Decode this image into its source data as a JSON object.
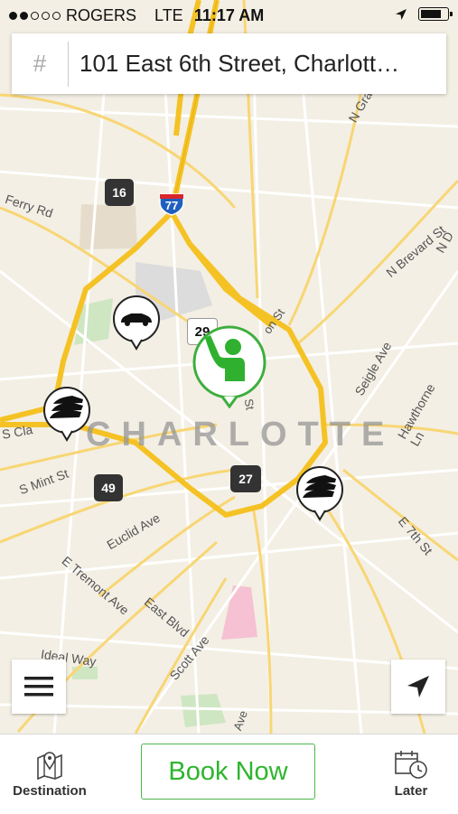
{
  "status_bar": {
    "carrier": "ROGERS",
    "network": "LTE",
    "time": "11:17 AM",
    "signal_dots_filled": 2,
    "signal_dots_total": 5
  },
  "search": {
    "hash_label": "#",
    "address": "101 East 6th Street, Charlott…"
  },
  "map": {
    "city_label": "CHARLOTTE",
    "streets": [
      "Ferry Rd",
      "N Gra",
      "N Brevard St",
      "N D",
      "Seigle Ave",
      "Hawthorne Ln",
      "S Mint St",
      "Euclid Ave",
      "E Tremont Ave",
      "East Blvd",
      "Scott Ave",
      "Ideal Way",
      "E 7th St",
      "S Cla",
      "Ave",
      "on St",
      "St"
    ],
    "shields": {
      "i77": "77",
      "r16": "16",
      "r29": "29",
      "r49": "49",
      "r27": "27"
    }
  },
  "tabbar": {
    "destination_label": "Destination",
    "book_label": "Book Now",
    "later_label": "Later"
  },
  "colors": {
    "accent": "#2db52d",
    "highway": "#f5c225",
    "map_bg": "#f3efe4"
  }
}
